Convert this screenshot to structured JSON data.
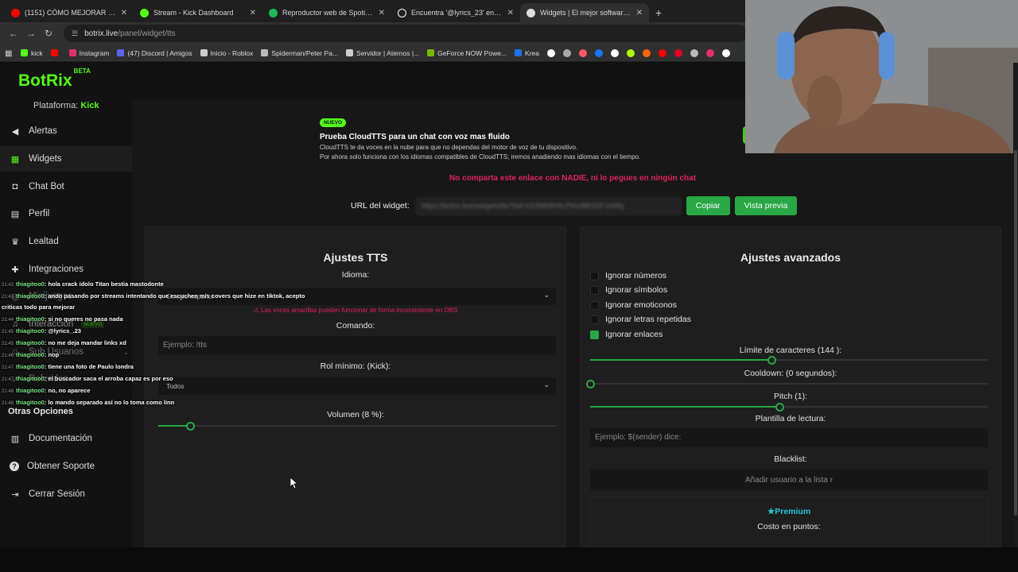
{
  "browser": {
    "tabs": [
      {
        "title": "(1151) CÓMO MEJORAR EL AU",
        "color": "#ff0000"
      },
      {
        "title": "Stream - Kick Dashboard",
        "color": "#53fc18"
      },
      {
        "title": "Reproductor web de Spotify: m",
        "color": "#1db954"
      },
      {
        "title": "Encuentra '@lyrics_23' en TikTo",
        "color": "#ffffff"
      },
      {
        "title": "Widgets | El mejor software par",
        "color": "#dddddd"
      }
    ],
    "new_tab": "+",
    "url_host": "botrix.live",
    "url_path": "/panel/widget/tts",
    "bookmarks": [
      "kick",
      "",
      "Instagram",
      "(47) Discord | Amigos",
      "Inicio - Roblox",
      "Spiderman/Peter Pa...",
      "Servidor | Aternos |...",
      "GeForce NOW Powe...",
      "Krea"
    ],
    "bookmark_colors": [
      "#53fc18",
      "#ff0000",
      "#e1306c",
      "#5865f2",
      "#cccccc",
      "#bbbbbb",
      "#cccccc",
      "#76b900",
      "#1a73e8"
    ],
    "bookmark_extra_icons": [
      "#ffffff",
      "#aaaaaa",
      "#ff5a5f",
      "#1877f2",
      "#ffffff",
      "#aaff00",
      "#ff6600",
      "#ff0000",
      "#e60023",
      "#bbbbbb",
      "#e1306c",
      "#ffffff"
    ]
  },
  "app": {
    "logo": "BotRix",
    "logo_sup": "BETA",
    "platform_label": "Plataforma:",
    "platform_value": "Kick",
    "nav": [
      {
        "label": "Alertas",
        "icon": "bullhorn-icon",
        "glyph": "📢"
      },
      {
        "label": "Widgets",
        "icon": "grid-icon",
        "glyph": "▦"
      },
      {
        "label": "Chat Bot",
        "icon": "robot-icon",
        "glyph": "🤖"
      },
      {
        "label": "Perfil",
        "icon": "id-card-icon",
        "glyph": "▤"
      },
      {
        "label": "Lealtad",
        "icon": "trophy-icon",
        "glyph": "🏆"
      },
      {
        "label": "Integraciones",
        "icon": "puzzle-icon",
        "glyph": "✚"
      },
      {
        "label": "Minijuegos",
        "icon": "gamepad-icon",
        "glyph": "🎮"
      },
      {
        "label": "Interaccion",
        "icon": "music-icon",
        "glyph": "♫",
        "badge": "NUEVO"
      },
      {
        "label": "Sub Usuarios",
        "icon": "users-icon",
        "glyph": "👥"
      },
      {
        "label": "Referidos",
        "icon": "share-icon",
        "glyph": "↗"
      }
    ],
    "other_title": "Otras Opciones",
    "other": [
      {
        "label": "Documentación",
        "icon": "book-icon",
        "glyph": "▥"
      },
      {
        "label": "Obtener Soporte",
        "icon": "help-icon",
        "glyph": "?"
      },
      {
        "label": "Cerrar Sesión",
        "icon": "logout-icon",
        "glyph": "⇥"
      }
    ],
    "promo": {
      "tag": "NUEVO",
      "title": "Prueba CloudTTS para un chat con voz mas fluido",
      "line1": "CloudTTS te da voces en la nube para que no dependas del motor de voz de tu dispositivo.",
      "line2": "Por ahora solo funciona con los idiomas compatibles de CloudTTS; iremos anadiendo mas idiomas con el tiempo."
    },
    "warning": "No comparta este enlace con NADIE, ni lo pegues en ningún chat",
    "url_label": "URL del widget:",
    "url_value": "https://botrix.live/widgets/tts?bid=h3JWk8hNLPt0u8tlhS2F1hWg",
    "copy_btn": "Copiar",
    "preview_btn": "Vista previa",
    "tts": {
      "title": "Ajustes TTS",
      "language_label": "Idioma:",
      "language_value": "Google español",
      "language_warning": "Las voces amarillas pueden funcionar de forma inconsistente en OBS",
      "command_label": "Comando:",
      "command_placeholder": "Ejemplo: !tts",
      "role_label": "Rol mínimo: (Kick):",
      "role_value": "Todos",
      "volume_label": "Volumen (8 %):",
      "volume": 0.08
    },
    "advanced": {
      "title": "Ajustes avanzados",
      "options": [
        {
          "label": "Ignorar números",
          "checked": false
        },
        {
          "label": "Ignorar símbolos",
          "checked": false
        },
        {
          "label": "Ignorar emoticonos",
          "checked": false
        },
        {
          "label": "Ignorar letras repetidas",
          "checked": false
        },
        {
          "label": "Ignorar enlaces",
          "checked": true
        }
      ],
      "char_limit_label": "Límite de caracteres (144 ):",
      "char_limit_fraction": 0.455,
      "cooldown_label": "Cooldown: (0 segundos):",
      "cooldown_fraction": 0.0,
      "pitch_label": "Pitch (1):",
      "pitch_fraction": 0.475,
      "template_label": "Plantilla de lectura:",
      "template_placeholder": "Ejemplo: $(sender) dice:",
      "blacklist_label": "Blacklist:",
      "blacklist_placeholder": "Añadir usuario a la lista r",
      "premium_label": "Premium",
      "cost_label": "Costo en puntos:"
    }
  },
  "chat": [
    {
      "time": "21:43",
      "user": "thiagitoo0",
      "msg": ": hola crack idolo Titan bestia mastodonte"
    },
    {
      "time": "21:43",
      "user": "thiagitoo0",
      "msg": ": ando pasando por streams intentando que escuchen mis covers que hize en tiktok, acepto"
    },
    {
      "time": "",
      "user": "",
      "msg": "criticas todo para mejorar"
    },
    {
      "time": "21:44",
      "user": "thiagitoo0",
      "msg": ": si no queres no pasa nada"
    },
    {
      "time": "21:45",
      "user": "thiagitoo0",
      "msg": ": @lyrics_.23"
    },
    {
      "time": "21:45",
      "user": "thiagitoo0",
      "msg": ": no me deja mandar links xd"
    },
    {
      "time": "21:46",
      "user": "thiagitoo0",
      "msg": ": nop"
    },
    {
      "time": "21:47",
      "user": "thiagitoo0",
      "msg": ": tiene una foto de Paulo londra"
    },
    {
      "time": "21:47",
      "user": "thiagitoo0",
      "msg": ": el buscador saca el arroba capaz es por eso"
    },
    {
      "time": "21:48",
      "user": "thiagitoo0",
      "msg": ": no, no aparece"
    },
    {
      "time": "21:48",
      "user": "thiagitoo0",
      "msg": ": lo mando separado así no lo toma como linn"
    }
  ]
}
